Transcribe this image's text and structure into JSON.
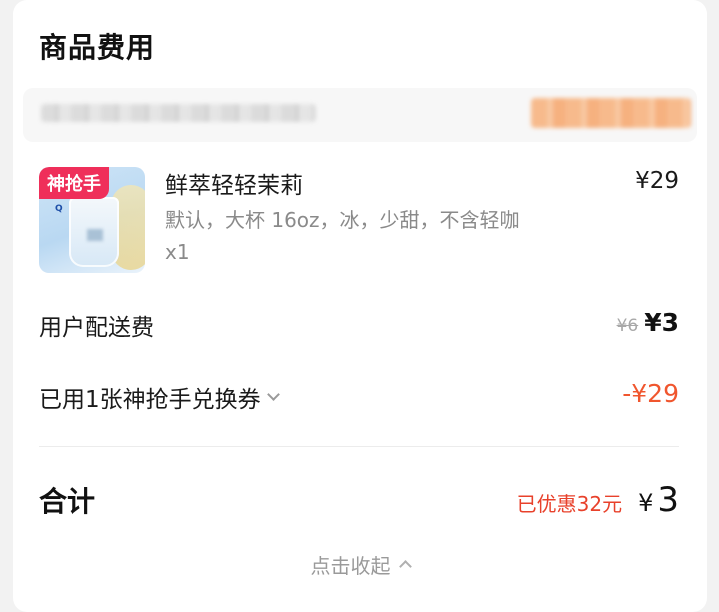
{
  "section": {
    "title": "商品费用"
  },
  "product": {
    "badge": "神抢手",
    "logo_text": "Q",
    "name": "鲜萃轻轻茉莉",
    "price": "¥29",
    "spec": "默认，大杯 16oz，冰，少甜，不含轻咖",
    "quantity": "x1"
  },
  "delivery": {
    "label": "用户配送费",
    "original_price": "¥6",
    "price": "¥3"
  },
  "coupon": {
    "label": "已用1张神抢手兑换券",
    "value": "-¥29"
  },
  "total": {
    "label": "合计",
    "saved": "已优惠32元",
    "currency": "¥",
    "amount": "3"
  },
  "footer": {
    "collapse_label": "点击收起"
  },
  "colors": {
    "accent_orange": "#f0562e",
    "accent_red": "#e8412b",
    "badge_pink": "#ef2f5a"
  }
}
